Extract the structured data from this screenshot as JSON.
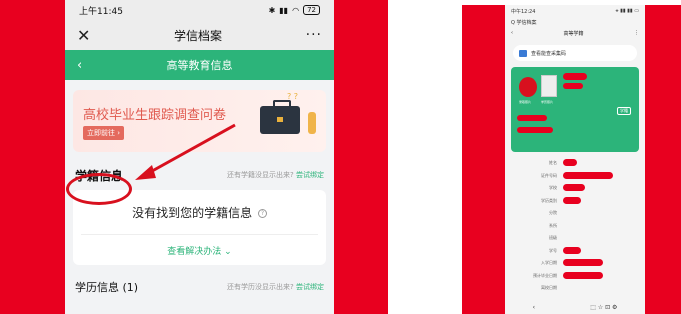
{
  "left": {
    "status": {
      "time": "上午11:45",
      "alarm_icon": "alarm-icon",
      "battery": "72"
    },
    "titlebar": {
      "close": "✕",
      "title": "学信档案",
      "more": "···"
    },
    "greenbar": {
      "back": "‹",
      "title": "高等教育信息"
    },
    "banner": {
      "title": "高校毕业生跟踪调查问卷",
      "button": "立即前往 ›"
    },
    "xueji": {
      "title": "学籍信息",
      "hint": "还有学籍没显示出来?",
      "bind": "尝试绑定"
    },
    "card": {
      "message": "没有找到您的学籍信息",
      "help": "?",
      "solve": "查看解决办法 ⌄"
    },
    "xueli": {
      "title": "学历信息 (1)",
      "hint": "还有学历没显示出来?",
      "bind": "尝试绑定"
    }
  },
  "right": {
    "status": {
      "time": "中午12:24",
      "icons": "⚹ ▮▮ ▮▮ ▭"
    },
    "app": {
      "name": "Q 学信档案"
    },
    "nav": {
      "back": "‹",
      "title": "高等学籍",
      "more": "⋮"
    },
    "search": {
      "text": "查看能查采集码"
    },
    "card": {
      "caption1": "录取照片",
      "caption2": "学历照片",
      "badge": "学籍"
    },
    "labels": [
      "姓名",
      "证件号码",
      "学校",
      "学历类别",
      "分院",
      "系所",
      "班级",
      "学号",
      "入学日期",
      "预计毕业日期",
      "离校日期"
    ],
    "bottom": {
      "back": "‹",
      "tabs": "⬚  ☆  ⊡  ⚙"
    }
  },
  "colors": {
    "accent_red": "#e8001f",
    "brand_green": "#2cb47a"
  }
}
